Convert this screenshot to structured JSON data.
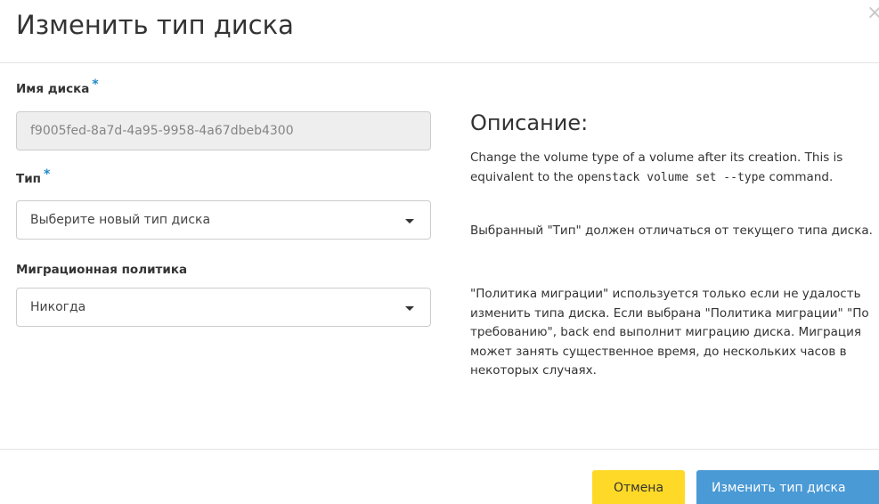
{
  "modal": {
    "title": "Изменить тип диска",
    "close_glyph": "×"
  },
  "form": {
    "volume_name": {
      "label": "Имя диска",
      "required_mark": "*",
      "value": "f9005fed-8a7d-4a95-9958-4a67dbeb4300"
    },
    "type": {
      "label": "Тип",
      "required_mark": "*",
      "selected": "Выберите новый тип диска"
    },
    "migration_policy": {
      "label": "Миграционная политика",
      "selected": "Никогда"
    }
  },
  "description": {
    "title": "Описание:",
    "p1_before": "Change the volume type of a volume after its creation. This is equivalent to the ",
    "p1_code": "openstack volume set --type",
    "p1_after": " command.",
    "p2": "Выбранный \"Тип\" должен отличаться от текущего типа диска.",
    "p3": "\"Политика миграции\" используется только если не удалость изменить типа диска. Если выбрана \"Политика миграции\" \"По требованию\", back end выполнит миграцию диска. Миграция может занять существенное время, до нескольких часов в некоторых случаях."
  },
  "footer": {
    "cancel_label": "Отмена",
    "submit_label": "Изменить тип диска"
  },
  "colors": {
    "accent_blue": "#4a9ad6",
    "cancel_yellow": "#ffd927",
    "required_star": "#1e88c8"
  }
}
